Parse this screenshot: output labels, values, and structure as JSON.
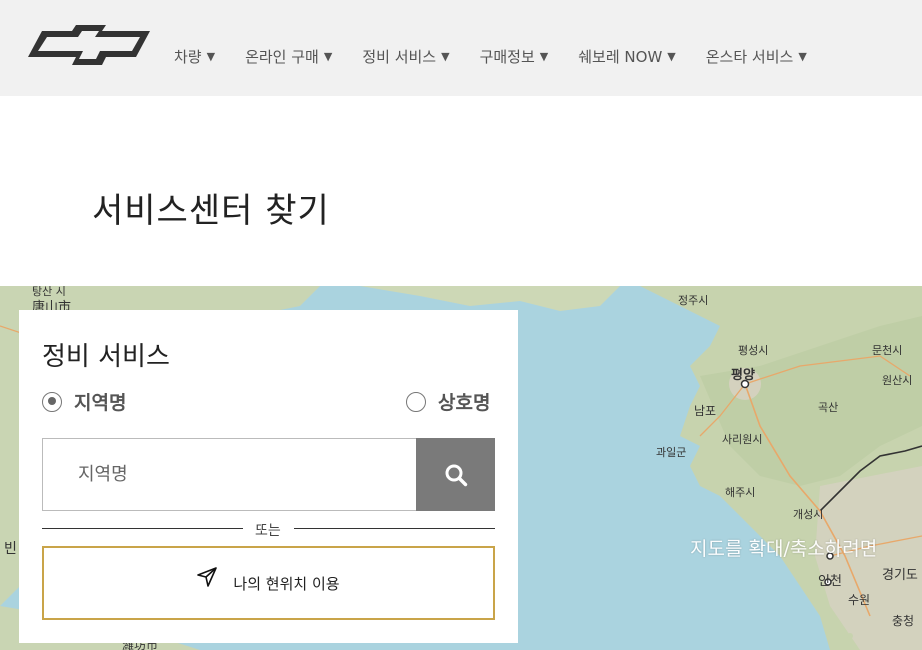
{
  "header": {
    "nav": [
      {
        "label": "차량",
        "caret": "▼"
      },
      {
        "label": "온라인 구매",
        "caret": "▼"
      },
      {
        "label": "정비 서비스",
        "caret": "▼"
      },
      {
        "label": "구매정보",
        "caret": "▼"
      },
      {
        "label": "쉐보레 NOW",
        "caret": "▼"
      },
      {
        "label": "온스타 서비스",
        "caret": "▼"
      }
    ]
  },
  "page": {
    "title": "서비스센터 찾기"
  },
  "map": {
    "hint": "지도를 확대/축소하려면",
    "labels": {
      "l1": "탕산 시",
      "l2": "唐山市",
      "l3": "정주시",
      "l4": "평성시",
      "l5": "문천시",
      "l6": "평양",
      "l7": "원산시",
      "l8": "남포",
      "l9": "곡산",
      "l10": "사리원시",
      "l11": "과일군",
      "l12": "해주시",
      "l13": "개성시",
      "l14": "인천",
      "l15": "경기도",
      "l16": "수원",
      "l17": "충청",
      "l18": "빈",
      "l19": "濰坊市"
    }
  },
  "panel": {
    "title": "정비 서비스",
    "radio_region": "지역명",
    "radio_company": "상호명",
    "search_placeholder": "지역명",
    "or_text": "또는",
    "locate_label": "나의 현위치 이용"
  },
  "colors": {
    "accent_gold": "#c9a449",
    "search_button": "#7a7a7a",
    "header_bg": "#f1f1f1",
    "sea": "#aad3df"
  }
}
